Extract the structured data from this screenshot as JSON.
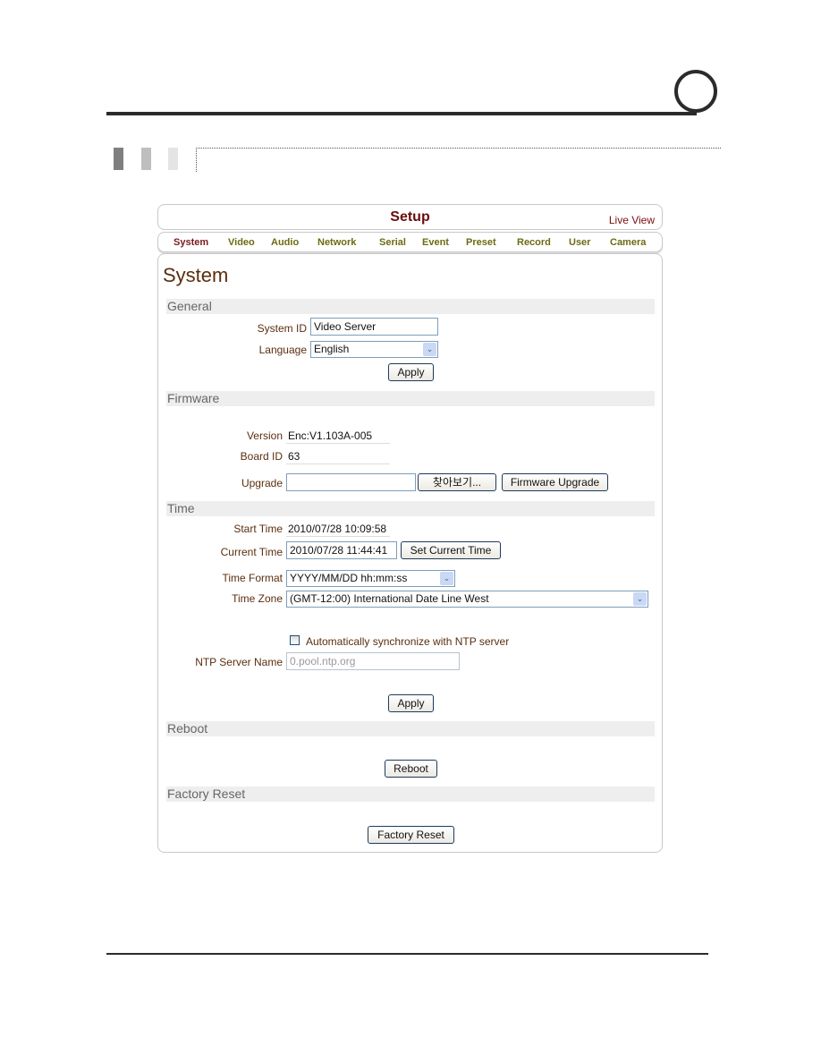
{
  "header": {
    "title": "Setup",
    "live_view": "Live View"
  },
  "nav": {
    "items": [
      {
        "label": "System",
        "active": true
      },
      {
        "label": "Video",
        "active": false
      },
      {
        "label": "Audio",
        "active": false
      },
      {
        "label": "Network",
        "active": false
      },
      {
        "label": "Serial",
        "active": false
      },
      {
        "label": "Event",
        "active": false
      },
      {
        "label": "Preset",
        "active": false
      },
      {
        "label": "Record",
        "active": false
      },
      {
        "label": "User",
        "active": false
      },
      {
        "label": "Camera",
        "active": false
      }
    ]
  },
  "page_title": "System",
  "general": {
    "title": "General",
    "system_id_label": "System ID",
    "system_id_value": "Video Server",
    "language_label": "Language",
    "language_value": "English",
    "apply_label": "Apply"
  },
  "firmware": {
    "title": "Firmware",
    "version_label": "Version",
    "version_value": "Enc:V1.103A-005",
    "board_id_label": "Board ID",
    "board_id_value": "63",
    "upgrade_label": "Upgrade",
    "upgrade_value": "",
    "browse_label": "찾아보기...",
    "firmware_upgrade_label": "Firmware Upgrade"
  },
  "time": {
    "title": "Time",
    "start_time_label": "Start Time",
    "start_time_value": "2010/07/28 10:09:58",
    "current_time_label": "Current Time",
    "current_time_value": "2010/07/28 11:44:41",
    "set_current_time_label": "Set Current Time",
    "time_format_label": "Time Format",
    "time_format_value": "YYYY/MM/DD hh:mm:ss",
    "time_zone_label": "Time Zone",
    "time_zone_value": "(GMT-12:00) International Date Line West",
    "ntp_sync_label": "Automatically synchronize with NTP server",
    "ntp_sync_checked": false,
    "ntp_server_label": "NTP Server Name",
    "ntp_server_value": "0.pool.ntp.org",
    "apply_label": "Apply"
  },
  "reboot": {
    "title": "Reboot",
    "button_label": "Reboot"
  },
  "factory_reset": {
    "title": "Factory Reset",
    "button_label": "Factory Reset"
  },
  "icons": {
    "dropdown_arrow": "⌄"
  }
}
